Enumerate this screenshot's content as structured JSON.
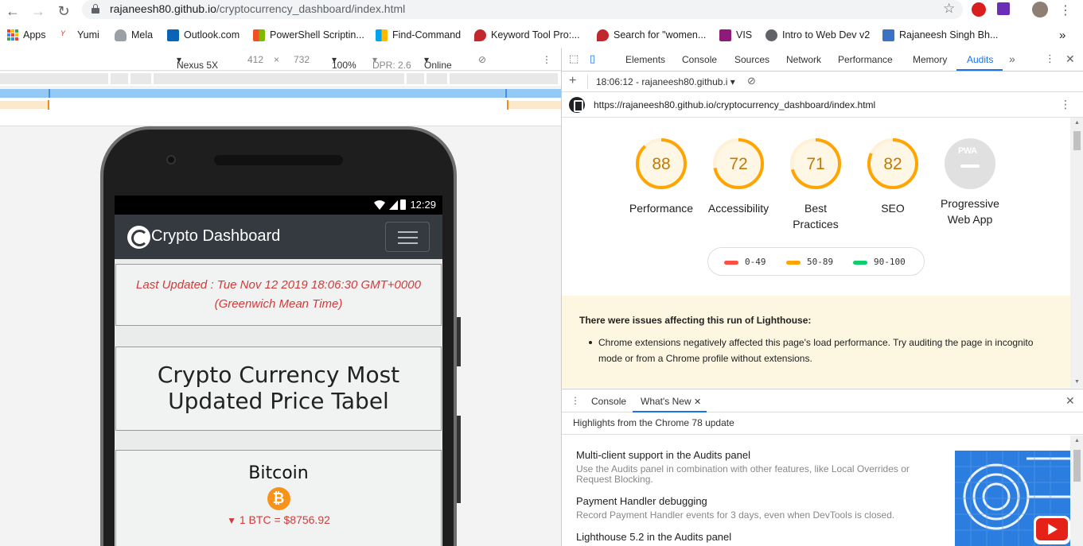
{
  "browser": {
    "url_host": "rajaneesh80.github.io",
    "url_path": "/cryptocurrency_dashboard/index.html",
    "bookmarks": [
      {
        "label": "Apps"
      },
      {
        "label": "Yumi"
      },
      {
        "label": "Mela"
      },
      {
        "label": "Outlook.com"
      },
      {
        "label": "PowerShell Scriptin..."
      },
      {
        "label": "Find-Command"
      },
      {
        "label": "Keyword Tool Pro:..."
      },
      {
        "label": "Search for \"women..."
      },
      {
        "label": "VIS"
      },
      {
        "label": "Intro to Web Dev v2"
      },
      {
        "label": "Rajaneesh Singh Bh..."
      }
    ],
    "more_bookmarks": "»"
  },
  "device_toolbar": {
    "device": "Nexus 5X",
    "width": "412",
    "times": "×",
    "height": "732",
    "zoom": "100%",
    "dpr": "DPR: 2.6",
    "network": "Online"
  },
  "phone": {
    "time": "12:29",
    "brand": "Crypto Dashboard",
    "last_updated_line1": "Last Updated : Tue Nov 12 2019 18:06:30 GMT+0000",
    "last_updated_line2": "(Greenwich Mean Time)",
    "table_title_line1": "Crypto Currency Most",
    "table_title_line2": "Updated Price Tabel",
    "coin_name": "Bitcoin",
    "coin_symbol": "₿",
    "coin_price": "1 BTC = $8756.92"
  },
  "devtools": {
    "tabs": [
      "Elements",
      "Console",
      "Sources",
      "Network",
      "Performance",
      "Memory",
      "Audits"
    ],
    "active_tab": "Audits",
    "report_selector": "18:06:12 - rajaneesh80.github.i",
    "report_url": "https://rajaneesh80.github.io/cryptocurrency_dashboard/index.html",
    "scores": [
      {
        "value": "88",
        "label": "Performance"
      },
      {
        "value": "72",
        "label": "Accessibility"
      },
      {
        "value": "71",
        "label_line1": "Best",
        "label_line2": "Practices"
      },
      {
        "value": "82",
        "label": "SEO"
      }
    ],
    "pwa": {
      "badge": "PWA",
      "label_line1": "Progressive",
      "label_line2": "Web App"
    },
    "legend": [
      {
        "range": "0-49",
        "color": "#ff4e42"
      },
      {
        "range": "50-89",
        "color": "#ffa400"
      },
      {
        "range": "90-100",
        "color": "#0cce6b"
      }
    ],
    "score_color": "#ffa400",
    "warning_title": "There were issues affecting this run of Lighthouse:",
    "warning_item": "Chrome extensions negatively affected this page's load performance. Try auditing the page in incognito mode or from a Chrome profile without extensions.",
    "drawer_tabs": [
      "Console",
      "What's New"
    ],
    "drawer_active": "What's New",
    "highlights": "Highlights from the Chrome 78 update",
    "features": [
      {
        "title": "Multi-client support in the Audits panel",
        "desc": "Use the Audits panel in combination with other features, like Local Overrides or Request Blocking."
      },
      {
        "title": "Payment Handler debugging",
        "desc": "Record Payment Handler events for 3 days, even when DevTools is closed."
      },
      {
        "title": "Lighthouse 5.2 in the Audits panel",
        "desc": ""
      }
    ]
  }
}
